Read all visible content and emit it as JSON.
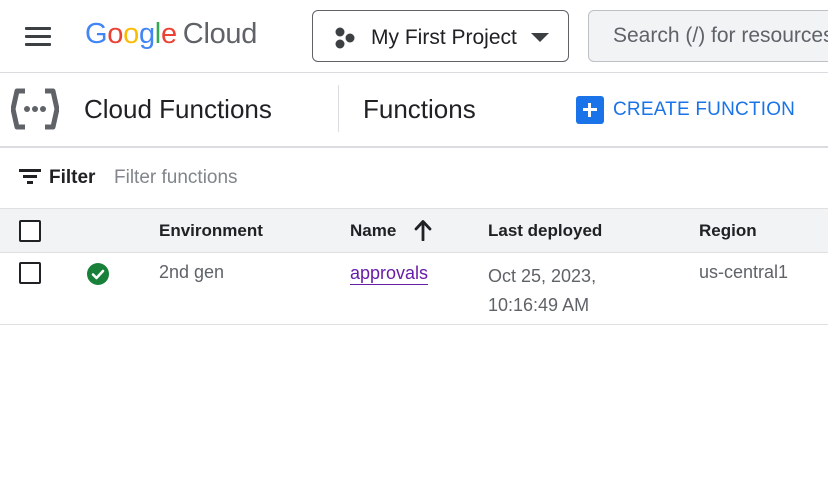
{
  "header": {
    "logo_letters": [
      "G",
      "o",
      "o",
      "g",
      "l",
      "e"
    ],
    "logo_suffix": "Cloud",
    "project": "My First Project",
    "search_placeholder": "Search (/) for resources"
  },
  "subheader": {
    "product": "Cloud Functions",
    "page_title": "Functions",
    "create_label": "CREATE FUNCTION"
  },
  "filter": {
    "label": "Filter",
    "placeholder": "Filter functions"
  },
  "table": {
    "columns": [
      "Environment",
      "Name",
      "Last deployed",
      "Region"
    ],
    "sort_column": "Name",
    "sort_direction": "ascending",
    "rows": [
      {
        "status": "ok",
        "environment": "2nd gen",
        "name": "approvals",
        "last_deployed_date": "Oct 25, 2023,",
        "last_deployed_time": "10:16:49 AM",
        "region": "us-central1"
      }
    ]
  },
  "colors": {
    "accent": "#1a73e8",
    "link": "#681da8",
    "status_ok": "#188038"
  },
  "icons": [
    "menu-icon",
    "project-hierarchy-icon",
    "dropdown-caret-icon",
    "cloud-functions-icon",
    "add-box-icon",
    "filter-list-icon",
    "sort-arrow-up-icon",
    "check-circle-icon"
  ]
}
